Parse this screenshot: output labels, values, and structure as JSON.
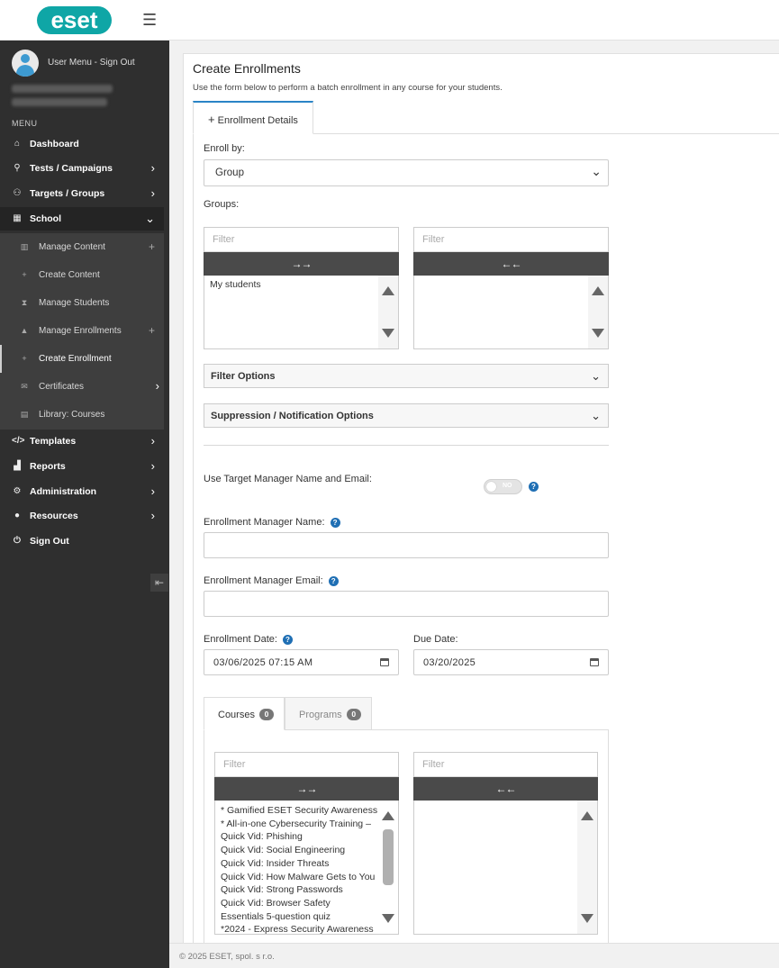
{
  "brand": {
    "logo_text": "eset"
  },
  "sidebar": {
    "user_menu": "User Menu -  Sign Out",
    "menu_heading": "MENU",
    "items": [
      {
        "label": "Dashboard",
        "icon": "home-icon"
      },
      {
        "label": "Tests / Campaigns",
        "icon": "phishing-icon"
      },
      {
        "label": "Targets / Groups",
        "icon": "users-icon"
      },
      {
        "label": "School",
        "icon": "school-icon"
      },
      {
        "label": "Templates",
        "icon": "code-icon"
      },
      {
        "label": "Reports",
        "icon": "chart-icon"
      },
      {
        "label": "Administration",
        "icon": "cogs-icon"
      },
      {
        "label": "Resources",
        "icon": "question-icon"
      },
      {
        "label": "Sign Out",
        "icon": "power-icon"
      }
    ],
    "school_sub": [
      {
        "label": "Manage Content"
      },
      {
        "label": "Create Content"
      },
      {
        "label": "Manage Students"
      },
      {
        "label": "Manage Enrollments"
      },
      {
        "label": "Create Enrollment"
      },
      {
        "label": "Certificates"
      },
      {
        "label": "Library: Courses"
      }
    ]
  },
  "page": {
    "title": "Create Enrollments",
    "subtitle": "Use the form below to perform a batch enrollment in any course for your students.",
    "tab": "Enrollment Details"
  },
  "form": {
    "enroll_by_label": "Enroll by:",
    "enroll_by_value": "Group",
    "groups_label": "Groups:",
    "filter_placeholder": "Filter",
    "move_right": "→→",
    "move_left": "←←",
    "groups_available": [
      "My students"
    ],
    "filter_options": "Filter Options",
    "suppression_options": "Suppression / Notification Options",
    "use_manager_label": "Use Target Manager Name and Email:",
    "toggle_text": "NO",
    "manager_name_label": "Enrollment Manager Name:",
    "manager_email_label": "Enrollment Manager Email:",
    "enrollment_date_label": "Enrollment Date:",
    "enrollment_date_value": "03/06/2025 07:15 AM",
    "due_date_label": "Due Date:",
    "due_date_value": "03/20/2025",
    "help_glyph": "?"
  },
  "subtabs": {
    "courses_label": "Courses",
    "courses_count": "0",
    "programs_label": "Programs",
    "programs_count": "0"
  },
  "courses_available": [
    "* Gamified ESET Security Awareness",
    "* All-in-one Cybersecurity Training –",
    "Quick Vid: Phishing",
    "Quick Vid: Social Engineering",
    "Quick Vid: Insider Threats",
    "Quick Vid: How Malware Gets to You",
    "Quick Vid: Strong Passwords",
    "Quick Vid: Browser Safety",
    "Essentials 5-question quiz",
    "*2024 - Express Security Awareness"
  ],
  "footer": {
    "text": "© 2025 ESET, spol. s r.o."
  },
  "colors": {
    "accent": "#0fa6a6",
    "sidebar": "#2f2f2f",
    "help": "#1f6fb4",
    "move_button": "#4a4a4a"
  }
}
